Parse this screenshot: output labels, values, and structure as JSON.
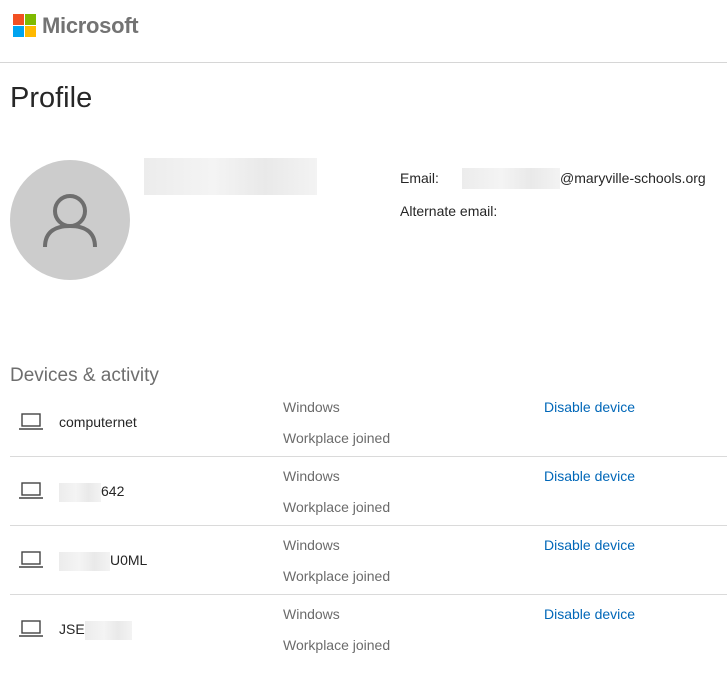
{
  "brand": {
    "name": "Microsoft"
  },
  "profile": {
    "title": "Profile",
    "email_label": "Email:",
    "email_domain": "@maryville-schools.org",
    "alt_email_label": "Alternate email:"
  },
  "devices_section": {
    "title": "Devices & activity",
    "action_label": "Disable device",
    "items": [
      {
        "name": "computernet",
        "os": "Windows",
        "join": "Workplace joined"
      },
      {
        "name_suffix": "642",
        "os": "Windows",
        "join": "Workplace joined"
      },
      {
        "name_suffix": "U0ML",
        "os": "Windows",
        "join": "Workplace joined"
      },
      {
        "name_prefix": "JSE",
        "os": "Windows",
        "join": "Workplace joined"
      }
    ]
  },
  "colors": {
    "link": "#0067b8",
    "avatar_bg": "#cccccc",
    "ms_red": "#f25022",
    "ms_green": "#7fba00",
    "ms_blue": "#00a4ef",
    "ms_yellow": "#ffb900"
  },
  "icons": [
    "microsoft-logo-icon",
    "person-icon",
    "laptop-icon"
  ]
}
